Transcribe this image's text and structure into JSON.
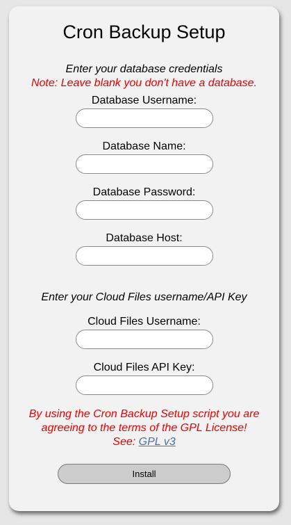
{
  "title": "Cron Backup Setup",
  "db_section": {
    "heading": "Enter your database credentials",
    "note": "Note: Leave blank you don't have a database."
  },
  "db_fields": [
    {
      "label": "Database Username:",
      "value": ""
    },
    {
      "label": "Database Name:",
      "value": ""
    },
    {
      "label": "Database Password:",
      "value": ""
    },
    {
      "label": "Database Host:",
      "value": ""
    }
  ],
  "cloud_section": {
    "heading": "Enter your Cloud Files username/API Key"
  },
  "cloud_fields": [
    {
      "label": "Cloud Files Username:",
      "value": ""
    },
    {
      "label": "Cloud Files API Key:",
      "value": ""
    }
  ],
  "license": {
    "text": "By using the Cron Backup Setup script you are agreeing to the terms of the GPL License!",
    "see_prefix": "See: ",
    "link_text": "GPL v3"
  },
  "install_button": "Install",
  "colors": {
    "background": "#e6e6e6",
    "card": "#f2f2f2",
    "warning": "#ee0000",
    "link": "#4f6ea8",
    "button": "#cccccc"
  }
}
